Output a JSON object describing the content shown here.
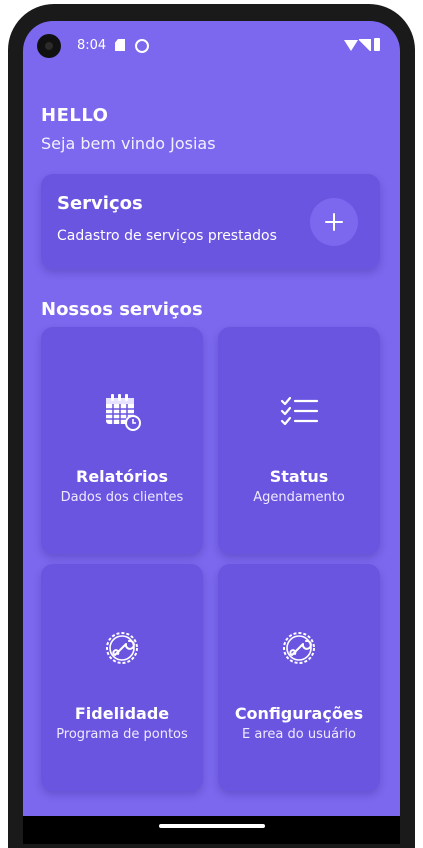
{
  "status_bar": {
    "time": "8:04"
  },
  "header": {
    "greeting": "HELLO",
    "welcome": "Seja bem vindo Josias"
  },
  "services_card": {
    "title": "Serviços",
    "subtitle": "Cadastro de serviços prestados",
    "add_icon": "plus-icon"
  },
  "section": {
    "title": "Nossos serviços"
  },
  "cards": [
    {
      "title": "Relatórios",
      "subtitle": "Dados dos clientes",
      "icon": "calendar-icon"
    },
    {
      "title": "Status",
      "subtitle": "Agendamento",
      "icon": "checklist-icon"
    },
    {
      "title": "Fidelidade",
      "subtitle": "Programa de pontos",
      "icon": "wrench-gear-icon"
    },
    {
      "title": "Configurações",
      "subtitle": "E area do usuário",
      "icon": "wrench-gear-icon"
    }
  ],
  "colors": {
    "background": "#7B68EE",
    "card": "#6A55E0",
    "text": "#FFFFFF"
  }
}
